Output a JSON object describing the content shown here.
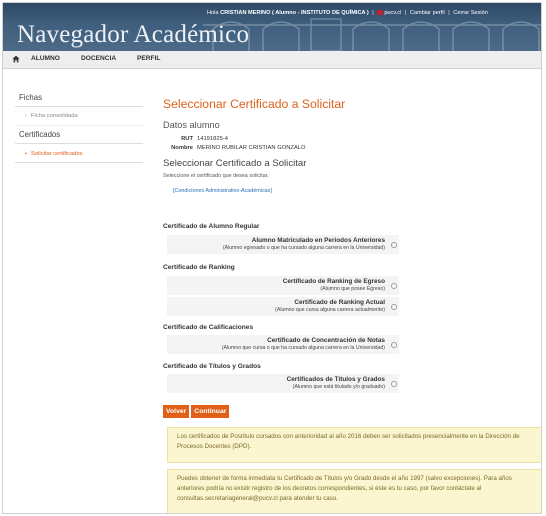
{
  "header": {
    "app_title": "Navegador Académico",
    "user_prefix": "Hola",
    "user_name": "CRISTIAN MERINO",
    "user_role": "( Alumno - INSTITUTO DE QUÍMICA )",
    "pucv_link": "pucv.cl",
    "change_profile": "Cambiar perfil",
    "logout": "Cerrar Sesión"
  },
  "nav": {
    "items": [
      "ALUMNO",
      "DOCENCIA",
      "PERFIL"
    ]
  },
  "sidebar": {
    "section1": "Fichas",
    "item1": "Ficha consolidada",
    "section2": "Certificados",
    "item2": "Solicitar certificados"
  },
  "main": {
    "title": "Seleccionar Certificado a Solicitar",
    "datos_title": "Datos alumno",
    "rut_label": "RUT",
    "rut_value": "14191825-4",
    "nombre_label": "Nombre",
    "nombre_value": "MERINO RUBILAR CRISTIAN GONZALO",
    "select_title": "Seleccionar Certificado a Solicitar",
    "instruction": "Seleccione el certificado que desea solicitar.",
    "conditions_link": "[Condiciones Administrativo-Académicas]",
    "categories": [
      {
        "name": "Certificado de Alumno Regular",
        "options": [
          {
            "name": "Alumno Matriculado en Periodos Anteriores",
            "desc": "(Alumno egresado o que ha cursado alguna carrera en la Universidad)"
          }
        ]
      },
      {
        "name": "Certificado de Ranking",
        "options": [
          {
            "name": "Certificado de Ranking de Egreso",
            "desc": "(Alumno que posee Egreso)"
          },
          {
            "name": "Certificado de Ranking Actual",
            "desc": "(Alumno que cursa alguna carrera actualmente)"
          }
        ]
      },
      {
        "name": "Certificado de Calificaciones",
        "options": [
          {
            "name": "Certificado de Concentración de Notas",
            "desc": "(Alumno que cursa o que ha cursado alguna carrera en la Universidad)"
          }
        ]
      },
      {
        "name": "Certificado de Títulos y Grados",
        "options": [
          {
            "name": "Certificados de Títulos y Grados",
            "desc": "(Alumno que está titulado y/o graduado)"
          }
        ]
      }
    ],
    "btn_back": "Volver",
    "btn_continue": "Continuar",
    "notice1": "Los certificados de Postítulo cursados con anterioridad al año 2016 deben ser solicitados presencialmente en la Dirección de Procesos Docentes (DPD).",
    "notice2": "Puedes obtener de forma inmediata tu Certificado de Títulos y/o Grado desde el año 1997 (salvo excepciones). Para años anteriores podría no existir registro de los decretos correspondientes, si éste es tu caso, por favor contáctate al consultas.secretariageneral@pucv.cl para atender tu caso."
  },
  "colors": {
    "accent": "#e0601a",
    "header_bg": "#3f5f7e",
    "notice_bg": "#fbf5d0",
    "link": "#2c6fb8"
  }
}
